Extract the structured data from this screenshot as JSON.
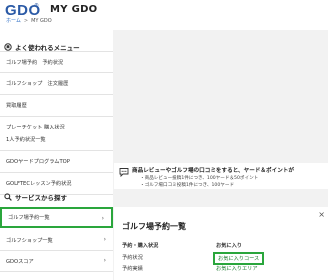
{
  "header": {
    "logo": "GDO",
    "logo_mark": "®",
    "title": "MY GDO",
    "breadcrumb": {
      "home": "ホーム",
      "separator": ">",
      "current": "MY GDO"
    },
    "colors": {
      "logo": "#2b5aa6",
      "link": "#2b6cc4"
    }
  },
  "favorites": {
    "heading": "よく使われるメニュー",
    "icon": "bookmark-icon",
    "items": [
      {
        "label": "ゴルフ場予約　予約状況"
      },
      {
        "label": "ゴルフショップ　注文履歴"
      },
      {
        "label": "買取履歴"
      },
      {
        "label": "プレーチケット 購入状況"
      },
      {
        "label": "1人予約状況一覧"
      },
      {
        "label": "GDOヤードプログラムTOP"
      },
      {
        "label": "GOLFTECレッスン予約状況"
      }
    ]
  },
  "services": {
    "heading": "サービスから探す",
    "icon": "search-icon",
    "items": [
      {
        "label": "ゴルフ場予約一覧",
        "active": true
      },
      {
        "label": "ゴルフショップ一覧",
        "active": false
      },
      {
        "label": "GDOスコア",
        "active": false
      }
    ],
    "active_color": "#2aa63c"
  },
  "promo": {
    "icon": "speech-bubble-icon",
    "line1": "商品レビューやゴルフ場の口コミをすると、ヤード＆ポイントが",
    "line2": "・商品レビュー投稿1件につき、100ヤード＆50ポイント",
    "line3": "・ゴルフ場口コミ投稿1件につき、100ヤード"
  },
  "panel": {
    "close_label": "×",
    "title": "ゴルフ場予約一覧",
    "left_column": {
      "heading": "予約・購入状況",
      "links": [
        "予約状況",
        "予約実績"
      ]
    },
    "right_column": {
      "heading": "お気に入り",
      "links": [
        {
          "label": "お気に入りコース",
          "highlighted": true
        },
        {
          "label": "お気に入りエリア",
          "highlighted": false
        }
      ]
    }
  }
}
